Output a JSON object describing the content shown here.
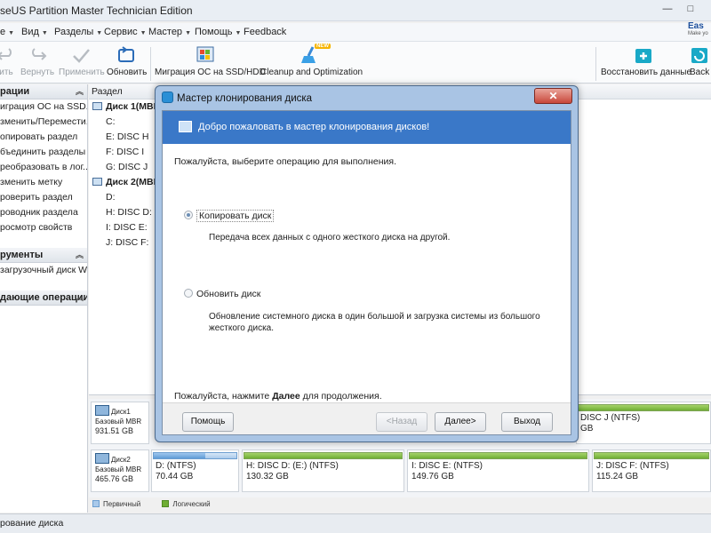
{
  "window": {
    "title": "seUS Partition Master Technician Edition",
    "min_label": "—",
    "max_label": "□"
  },
  "brand": {
    "text": "Eas",
    "sub": "Make yo"
  },
  "menu": [
    {
      "label": "e"
    },
    {
      "label": "Вид"
    },
    {
      "label": "Разделы"
    },
    {
      "label": "Сервис"
    },
    {
      "label": "Мастер"
    },
    {
      "label": "Помощь"
    },
    {
      "label": "Feedback"
    }
  ],
  "toolbar": {
    "undo": "ить",
    "redo": "Вернуть",
    "apply": "Применить",
    "refresh": "Обновить",
    "migrate": "Миграция ОС на SSD/HDD",
    "cleanup": "Cleanup and Optimization",
    "cleanup_badge": "NEW",
    "restore": "Восстановить данные",
    "backup": "Back"
  },
  "left_panel": {
    "operations_header": "рации",
    "operations": [
      "играция ОС на SSD...",
      "зменить/Перемести...",
      "опировать раздел",
      "бъединить разделы",
      "реобразовать в лог...",
      "зменить метку",
      "роверить раздел",
      "роводник раздела",
      "росмотр свойств"
    ],
    "tools_header": "рументы",
    "tools": [
      "загрузочный диск Wi..."
    ],
    "pending_header": "дающие операции"
  },
  "partition_list": {
    "column_header": "Раздел",
    "rows": [
      {
        "label": "Диск 1(MBR",
        "disk": true
      },
      {
        "label": "C:",
        "disk": false
      },
      {
        "label": "E: DISC H",
        "disk": false
      },
      {
        "label": "F: DISC I",
        "disk": false
      },
      {
        "label": "G: DISC J",
        "disk": false
      },
      {
        "label": "Диск 2(MBR",
        "disk": true
      },
      {
        "label": "D:",
        "disk": false
      },
      {
        "label": "H: DISC D:",
        "disk": false
      },
      {
        "label": "I: DISC E:",
        "disk": false
      },
      {
        "label": "J: DISC F:",
        "disk": false
      }
    ]
  },
  "disk_map": {
    "disk1": {
      "name": "Диск1",
      "type": "Базовый MBR",
      "size": "931.51 GB",
      "partitions": [
        {
          "name": "DISC J (NTFS)",
          "size": "GB"
        }
      ]
    },
    "disk2": {
      "name": "Диск2",
      "type": "Базовый MBR",
      "size": "465.76 GB",
      "partitions": [
        {
          "name": "D: (NTFS)",
          "size": "70.44 GB"
        },
        {
          "name": "H: DISC D: (E:) (NTFS)",
          "size": "130.32 GB"
        },
        {
          "name": "I: DISC E: (NTFS)",
          "size": "149.76 GB"
        },
        {
          "name": "J: DISC F: (NTFS)",
          "size": "115.24 GB"
        }
      ]
    }
  },
  "legend": {
    "primary": "Первичный",
    "logical": "Логический"
  },
  "status_bar": {
    "text": "рование диска"
  },
  "dialog": {
    "title": "Мастер клонирования диска",
    "close": "✕",
    "banner": "Добро пожаловать в мастер клонирования дисков!",
    "prompt": "Пожалуйста, выберите операцию для выполнения.",
    "options": [
      {
        "label": "Копировать диск",
        "description": "Передача всех данных с одного жесткого диска на другой.",
        "checked": true
      },
      {
        "label": "Обновить диск",
        "description": "Обновление системного диска в один большой и загрузка системы из большого жесткого диска.",
        "checked": false
      }
    ],
    "continue_prefix": "Пожалуйста, нажмите ",
    "continue_bold": "Далее",
    "continue_suffix": " для продолжения.",
    "buttons": {
      "help": "Помощь",
      "back": "<Назад",
      "next": "Далее>",
      "exit": "Выход"
    }
  },
  "colors": {
    "banner": "#3a78c8",
    "logical": "#6fae34",
    "primary": "#a9c9ea",
    "dialog_frame": "#a9c4e4"
  }
}
